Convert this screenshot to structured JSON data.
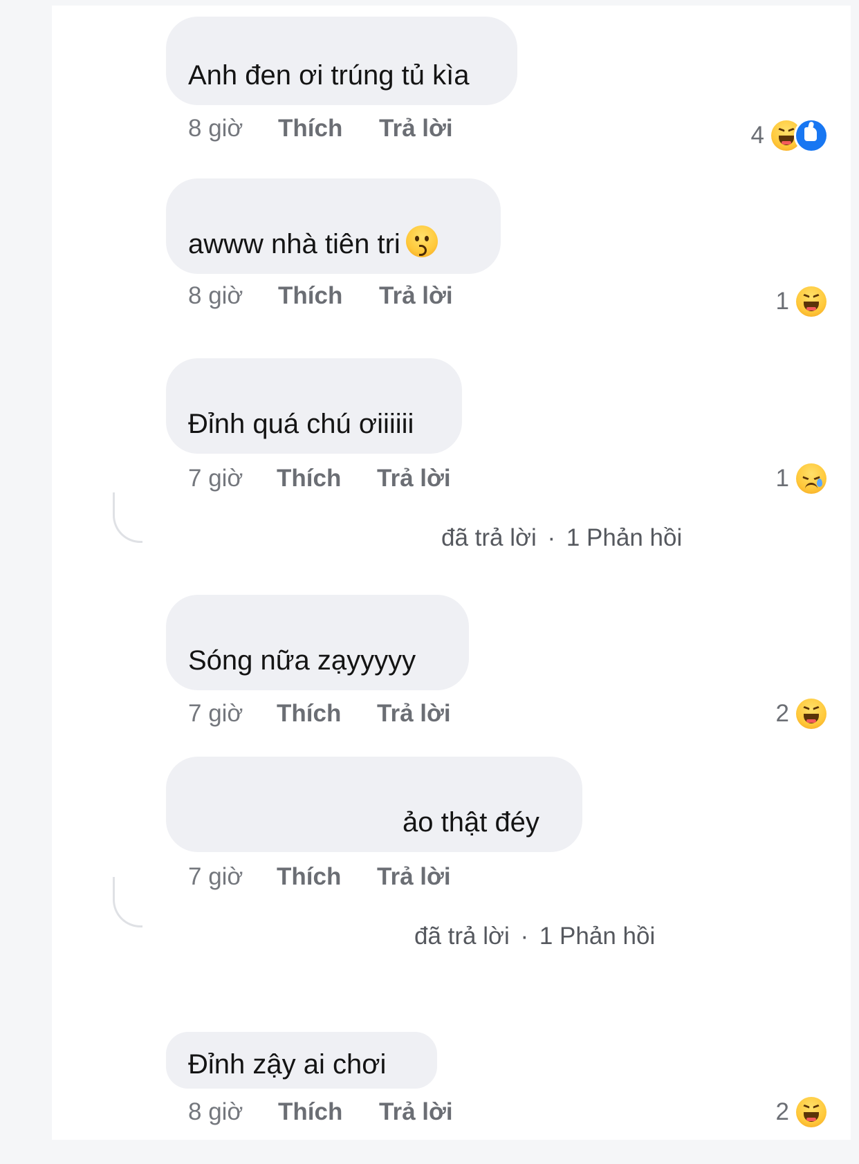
{
  "comments": [
    {
      "text": "Anh đen ơi trúng tủ kìa",
      "time": "8 giờ",
      "like_label": "Thích",
      "reply_label": "Trả lời",
      "reaction_count": "4",
      "reactions": [
        "haha-icon",
        "like-icon"
      ]
    },
    {
      "text": "awww nhà tiên tri",
      "emoji": "kissing-face-icon",
      "time": "8 giờ",
      "like_label": "Thích",
      "reply_label": "Trả lời",
      "reaction_count": "1",
      "reactions": [
        "haha-icon"
      ]
    },
    {
      "text": "Đỉnh quá chú ơiiiiii",
      "time": "7 giờ",
      "like_label": "Thích",
      "reply_label": "Trả lời",
      "reaction_count": "1",
      "reactions": [
        "sad-icon"
      ],
      "replies_summary": {
        "replied": "đã trả lời",
        "count": "1 Phản hồi"
      }
    },
    {
      "text": "Sóng nữa zạyyyyy",
      "time": "7 giờ",
      "like_label": "Thích",
      "reply_label": "Trả lời",
      "reaction_count": "2",
      "reactions": [
        "haha-icon"
      ]
    },
    {
      "text": "ảo thật đéy",
      "time": "7 giờ",
      "like_label": "Thích",
      "reply_label": "Trả lời",
      "replies_summary": {
        "replied": "đã trả lời",
        "count": "1 Phản hồi"
      }
    },
    {
      "text": "Đỉnh zậy ai chơi",
      "time": "8 giờ",
      "like_label": "Thích",
      "reply_label": "Trả lời",
      "reaction_count": "2",
      "reactions": [
        "haha-icon"
      ]
    }
  ],
  "separator": "·",
  "colors": {
    "bubble": "#eff0f4",
    "like_blue": "#1877f2",
    "meta_gray": "#6b6e74"
  }
}
